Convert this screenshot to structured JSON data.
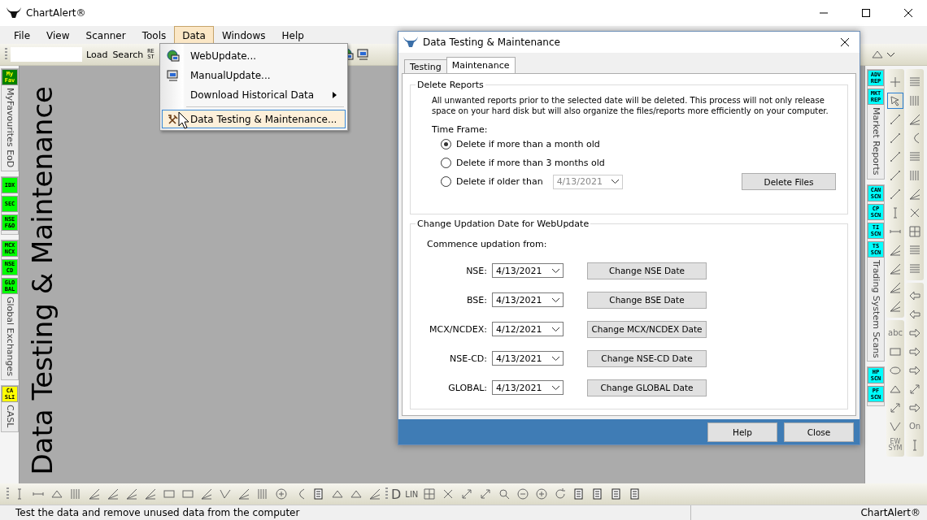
{
  "window": {
    "title": "ChartAlert®"
  },
  "menu": [
    {
      "label": "File",
      "selected": false
    },
    {
      "label": "View",
      "selected": false
    },
    {
      "label": "Scanner",
      "selected": false
    },
    {
      "label": "Tools",
      "selected": false
    },
    {
      "label": "Data",
      "selected": true
    },
    {
      "label": "Windows",
      "selected": false
    },
    {
      "label": "Help",
      "selected": false
    }
  ],
  "toolbar": {
    "buttons": [
      "Load",
      "Search"
    ],
    "cut_badge": "RE ST"
  },
  "data_menu": [
    {
      "label": "WebUpdate...",
      "selected": false,
      "submenu": false,
      "separator_before": false
    },
    {
      "label": "ManualUpdate...",
      "selected": false,
      "submenu": false,
      "separator_before": false
    },
    {
      "label": "Download Historical Data",
      "selected": false,
      "submenu": true,
      "separator_before": false
    },
    {
      "label": "Data Testing & Maintenance...",
      "selected": true,
      "submenu": false,
      "separator_before": true
    }
  ],
  "left_panel": [
    {
      "badges": [
        {
          "text": "My Fav",
          "color": "#008000"
        }
      ],
      "label": "MyFavourites EoD"
    },
    {
      "badges": [
        {
          "text": "IDX",
          "color": "#00ff00"
        },
        {
          "text": "SEC",
          "color": "#00ff00"
        },
        {
          "text": "NSE F&O",
          "color": "#00ff00"
        }
      ]
    },
    {
      "badges": [
        {
          "text": "MCX NCX",
          "color": "#00ff00"
        },
        {
          "text": "NSE CD",
          "color": "#00ff00"
        },
        {
          "text": "GLO BAL",
          "color": "#00ff00"
        }
      ],
      "label": "Global Exchanges"
    },
    {
      "badges": [
        {
          "text": "CA SLI",
          "color": "#ffff00"
        }
      ],
      "label": "CASL"
    }
  ],
  "canvas_title": "Data Testing & Maintenance",
  "right_panel": [
    {
      "badges": [
        {
          "text": "ADV REP",
          "color": "#00ffff"
        },
        {
          "text": "MKT REP",
          "color": "#00ffff"
        }
      ],
      "label": "Market Reports"
    },
    {
      "badges": [
        {
          "text": "CAN SCN",
          "color": "#00ffff"
        },
        {
          "text": "CP SCN",
          "color": "#00ffff"
        },
        {
          "text": "TI SCN",
          "color": "#00ffff"
        },
        {
          "text": "TS SCN",
          "color": "#00ffff"
        }
      ],
      "label": "Trading System Scans"
    },
    {
      "badges": [
        {
          "text": "HP SCN",
          "color": "#00ffff"
        },
        {
          "text": "PF SCN",
          "color": "#00ffff"
        }
      ]
    }
  ],
  "drawing_tools": {
    "pointer_selected": true,
    "texts": [
      "abc",
      "EW SYM",
      "On"
    ]
  },
  "bottom_toolbar": {
    "texts": [
      "D",
      "LIN"
    ]
  },
  "dialog": {
    "title": "Data Testing & Maintenance",
    "tabs": [
      {
        "label": "Testing",
        "selected": false
      },
      {
        "label": "Maintenance",
        "selected": true
      }
    ],
    "delete_reports": {
      "title": "Delete Reports",
      "description": "All unwanted reports prior to the selected date will be deleted. This process will not only release space on your hard disk but will also organize the files/reports more efficiently on your computer.",
      "time_frame_label": "Time Frame:",
      "options": [
        {
          "label": "Delete if more than a month old",
          "selected": true
        },
        {
          "label": "Delete if more than 3 months old",
          "selected": false
        },
        {
          "label": "Delete if older than",
          "selected": false
        }
      ],
      "date": {
        "value": "4/13/2021",
        "disabled": true
      },
      "button": "Delete Files"
    },
    "change_updation": {
      "title": "Change Updation Date for WebUpdate",
      "commence_label": "Commence updation from:",
      "rows": [
        {
          "label": "NSE:",
          "date": "4/13/2021",
          "button": "Change NSE Date"
        },
        {
          "label": "BSE:",
          "date": "4/13/2021",
          "button": "Change BSE Date"
        },
        {
          "label": "MCX/NCDEX:",
          "date": "4/12/2021",
          "button": "Change MCX/NCDEX Date"
        },
        {
          "label": "NSE-CD:",
          "date": "4/13/2021",
          "button": "Change NSE-CD Date"
        },
        {
          "label": "GLOBAL:",
          "date": "4/13/2021",
          "button": "Change GLOBAL Date"
        }
      ]
    },
    "buttons": [
      "Help",
      "Close"
    ]
  },
  "status_bar": {
    "message": "Test the data and remove unused data from the computer",
    "app": "ChartAlert®"
  }
}
